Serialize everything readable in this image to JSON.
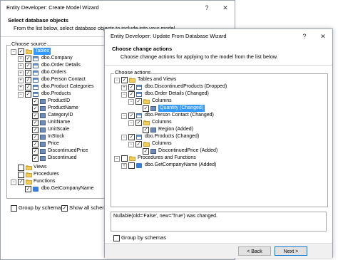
{
  "back_window": {
    "title": "Entity Developer: Create Model Wizard",
    "header_title": "Select database objects",
    "header_sub": "From the list below, select database objects to include into your model.",
    "group_label": "Choose source",
    "tree": [
      "Tables",
      "dbo.Company",
      "dbo.Order Details",
      "dbo.Orders",
      "dbo.Person Contact",
      "dbo.Product Categories",
      "dbo.Products",
      "ProductID",
      "ProductName",
      "CategoryID",
      "UnitName",
      "UnitScale",
      "InStock",
      "Price",
      "DiscontinuedPrice",
      "Discontinued",
      "Views",
      "Procedures",
      "Functions",
      "dbo.GetCompanyName"
    ],
    "group_by_schemas": "Group by schemas",
    "show_all": "Show all schemas"
  },
  "front_window": {
    "title": "Entity Developer: Update From Database Wizard",
    "header_title": "Choose change actions",
    "header_sub": "Choose change actions for applying to the model from the list below.",
    "group_label": "Choose actions",
    "tree": [
      "Tables and Views",
      "dbo.DiscontinuedProducts (Dropped)",
      "dbo.Order Details (Changed)",
      "Columns",
      "Quantity (Changed)",
      "dbo.Person Contact (Changed)",
      "Columns",
      "Region (Added)",
      "dbo.Products (Changed)",
      "Columns",
      "DiscontinuedPrice (Added)",
      "Procedures and Functions",
      "dbo.GetCompanyName (Added)"
    ],
    "details": "Nullable(old='False', new='True') was changed.",
    "group_by_schemas": "Group by schemas",
    "back_button": "< Back",
    "next_button": "Next >"
  },
  "icons": {
    "close": "close-icon",
    "help": "help-icon"
  },
  "colors": {
    "selection": "#3399ff",
    "folder": "#f2cd5c"
  }
}
